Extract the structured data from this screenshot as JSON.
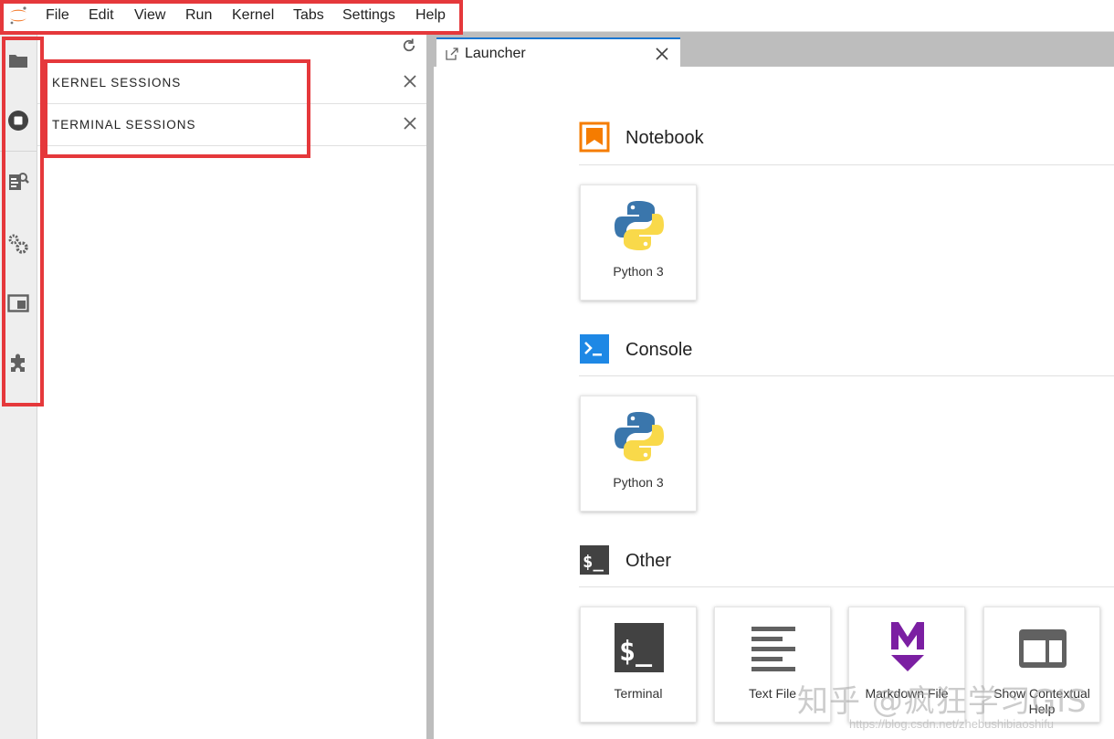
{
  "menubar": {
    "items": [
      "File",
      "Edit",
      "View",
      "Run",
      "Kernel",
      "Tabs",
      "Settings",
      "Help"
    ]
  },
  "activitybar": {
    "icons": [
      "folder-icon",
      "stop-circle-icon",
      "property-inspector-icon",
      "cogs-icon",
      "tabs-icon",
      "extension-icon"
    ]
  },
  "leftpanel": {
    "sections": [
      {
        "label": "KERNEL SESSIONS"
      },
      {
        "label": "TERMINAL SESSIONS"
      }
    ]
  },
  "main": {
    "tab_label": "Launcher"
  },
  "launcher": {
    "notebook": {
      "title": "Notebook",
      "cards": [
        {
          "label": "Python 3"
        }
      ]
    },
    "console": {
      "title": "Console",
      "cards": [
        {
          "label": "Python 3"
        }
      ]
    },
    "other": {
      "title": "Other",
      "cards": [
        {
          "label": "Terminal"
        },
        {
          "label": "Text File"
        },
        {
          "label": "Markdown File"
        },
        {
          "label": "Show Contextual Help"
        }
      ]
    }
  },
  "watermark": {
    "text": "知乎 @疯狂学习GIS",
    "url": "https://blog.csdn.net/zhebushibiaoshifu"
  },
  "colors": {
    "accent_blue": "#1976d2",
    "highlight_red": "#e5383b",
    "notebook_orange": "#f57c00",
    "console_blue": "#1e88e5",
    "markdown_purple": "#7b1fa2"
  }
}
